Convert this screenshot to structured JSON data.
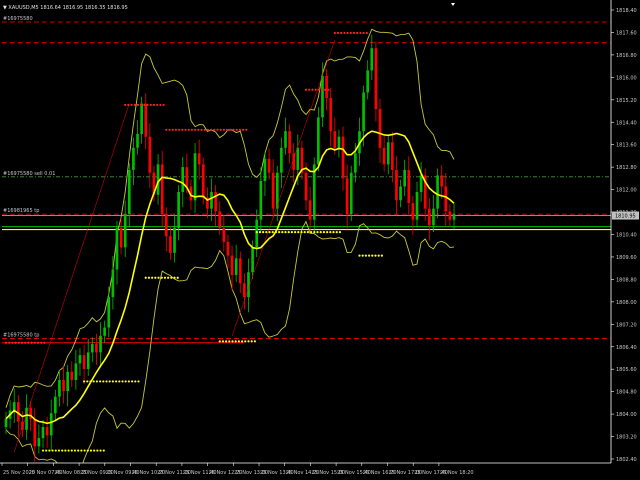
{
  "header": {
    "symbol_line": "▼ XAUUSD,M5 1816.64 1816.95 1816.35 1816.95",
    "order_label": "#16975580"
  },
  "colors": {
    "background": "#000000",
    "bull_candle": "#00c000",
    "bear_candle": "#ff0000",
    "ma_line": "#ffff00",
    "bands_line": "#c8c83c",
    "level_line": "#ff0000",
    "current_price_line": "#c0c0c0",
    "order_line_green": "#00c000",
    "marker_red": "#ff2020",
    "marker_yellow": "#ffff00"
  },
  "levels": [
    {
      "text": "#16975580",
      "price": 1817.95
    },
    {
      "text": "",
      "price": 1817.2
    },
    {
      "text": "#16975580 sell 0.01",
      "price": 1812.35
    },
    {
      "text": "#16981965 tp",
      "price": 1811.0
    },
    {
      "text": "#16975580 tp",
      "price": 1806.5
    }
  ],
  "price_axis": {
    "labels": [
      "1818.40",
      "1817.60",
      "1816.80",
      "1816.00",
      "1815.20",
      "1814.40",
      "1813.60",
      "1812.80",
      "1812.00",
      "1811.20",
      "1810.40",
      "1809.60",
      "1808.80",
      "1808.00",
      "1807.20",
      "1806.40",
      "1805.60",
      "1804.80",
      "1804.00",
      "1803.20",
      "1802.40"
    ],
    "current_price": "1810.95"
  },
  "time_axis": {
    "labels": [
      "25 Nov 2020",
      "25 Nov 07:40",
      "25 Nov 08:20",
      "25 Nov 09:00",
      "25 Nov 09:40",
      "25 Nov 10:20",
      "25 Nov 11:00",
      "25 Nov 11:40",
      "25 Nov 12:20",
      "25 Nov 13:00",
      "25 Nov 13:40",
      "25 Nov 14:20",
      "25 Nov 15:00",
      "25 Nov 15:40",
      "25 Nov 16:20",
      "25 Nov 17:00",
      "25 Nov 17:40",
      "25 Nov 18:20"
    ]
  },
  "chart_data": {
    "type": "candlestick",
    "ylim": [
      1802.0,
      1818.6
    ],
    "close_prices": [
      1803.6,
      1803.9,
      1804.2,
      1803.5,
      1803.2,
      1804.0,
      1803.6,
      1802.6,
      1802.9,
      1803.3,
      1803.0,
      1803.8,
      1804.4,
      1805.0,
      1804.6,
      1805.3,
      1805.0,
      1805.6,
      1805.9,
      1805.4,
      1806.0,
      1806.3,
      1806.0,
      1806.6,
      1806.9,
      1808.0,
      1809.0,
      1810.5,
      1809.8,
      1811.0,
      1812.6,
      1813.4,
      1813.9,
      1815.0,
      1813.8,
      1812.5,
      1811.7,
      1812.8,
      1811.0,
      1810.2,
      1809.6,
      1810.5,
      1811.8,
      1812.7,
      1812.0,
      1811.5,
      1813.2,
      1812.8,
      1811.6,
      1811.2,
      1811.8,
      1811.1,
      1810.5,
      1810.0,
      1809.5,
      1808.8,
      1809.4,
      1808.5,
      1808.0,
      1808.9,
      1809.8,
      1810.8,
      1812.2,
      1813.0,
      1812.5,
      1811.2,
      1812.5,
      1813.4,
      1814.0,
      1813.2,
      1812.6,
      1813.4,
      1812.5,
      1811.5,
      1810.8,
      1812.8,
      1814.5,
      1816.0,
      1815.2,
      1814.0,
      1813.4,
      1813.8,
      1812.3,
      1811.0,
      1812.5,
      1813.2,
      1814.0,
      1815.4,
      1816.2,
      1817.0,
      1814.8,
      1813.4,
      1812.8,
      1813.6,
      1812.6,
      1811.5,
      1812.0,
      1812.6,
      1811.4,
      1810.8,
      1811.8,
      1812.4,
      1811.2,
      1810.6,
      1811.2,
      1812.4,
      1812.0,
      1811.1,
      1810.8,
      1811.0
    ]
  },
  "markers": {
    "red_rows": [
      {
        "price": 1817.55,
        "i0": 80,
        "i1": 88
      },
      {
        "price": 1815.5,
        "i0": 73,
        "i1": 79
      },
      {
        "price": 1814.95,
        "i0": 29,
        "i1": 39
      },
      {
        "price": 1814.05,
        "i0": 39,
        "i1": 59
      },
      {
        "price": 1806.35,
        "i0": 0,
        "i1": 10
      }
    ],
    "yellow_rows": [
      {
        "price": 1810.35,
        "i0": 61,
        "i1": 82
      },
      {
        "price": 1809.5,
        "i0": 86,
        "i1": 92
      },
      {
        "price": 1808.7,
        "i0": 34,
        "i1": 42
      },
      {
        "price": 1806.4,
        "i0": 52,
        "i1": 61
      },
      {
        "price": 1804.95,
        "i0": 19,
        "i1": 33
      },
      {
        "price": 1802.45,
        "i0": 9,
        "i1": 24
      }
    ]
  }
}
